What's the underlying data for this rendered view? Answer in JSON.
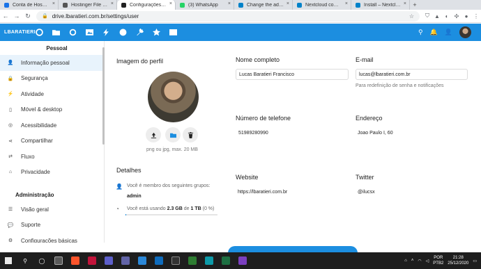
{
  "browser": {
    "tabs": [
      {
        "title": "Conta de Hospedagem",
        "color": "#1a73e8",
        "active": false
      },
      {
        "title": "Hostinger File Manager",
        "color": "#555555",
        "active": false
      },
      {
        "title": "Configurações - drive",
        "color": "#222222",
        "active": true
      },
      {
        "title": "(3) WhatsApp",
        "color": "#25d366",
        "active": false
      },
      {
        "title": "Change the address of",
        "color": "#0082c9",
        "active": false
      },
      {
        "title": "Nextcloud community",
        "color": "#0082c9",
        "active": false
      },
      {
        "title": "Install – Nextcloud",
        "color": "#0082c9",
        "active": false
      }
    ],
    "url": "drive.lbaratieri.com.br/settings/user"
  },
  "header": {
    "logo": "LBARATIERI",
    "apps": [
      "dashboard-icon",
      "files-icon",
      "talk-icon",
      "photos-icon",
      "activity-icon",
      "circles-icon",
      "settings-icon",
      "favorites-icon",
      "contacts-icon"
    ]
  },
  "sidebar": {
    "personal_heading": "Pessoal",
    "personal_items": [
      {
        "label": "Informação pessoal",
        "icon": "person-icon",
        "glyph": "👤",
        "active": true
      },
      {
        "label": "Segurança",
        "icon": "lock-icon",
        "glyph": "🔒",
        "active": false
      },
      {
        "label": "Atividade",
        "icon": "lightning-icon",
        "glyph": "⚡",
        "active": false
      },
      {
        "label": "Móvel & desktop",
        "icon": "phone-icon",
        "glyph": "▯",
        "active": false
      },
      {
        "label": "Acessibilidade",
        "icon": "accessibility-icon",
        "glyph": "◎",
        "active": false
      },
      {
        "label": "Compartilhar",
        "icon": "share-icon",
        "glyph": "⋖",
        "active": false
      },
      {
        "label": "Fluxo",
        "icon": "flow-icon",
        "glyph": "⇄",
        "active": false
      },
      {
        "label": "Privacidade",
        "icon": "privacy-icon",
        "glyph": "⌂",
        "active": false
      }
    ],
    "admin_heading": "Administração",
    "admin_items": [
      {
        "label": "Visão geral",
        "icon": "list-icon",
        "glyph": "☰"
      },
      {
        "label": "Suporte",
        "icon": "chat-icon",
        "glyph": "💬"
      },
      {
        "label": "Configurações básicas",
        "icon": "gear-icon",
        "glyph": "⚙"
      }
    ]
  },
  "profile": {
    "picture_label": "Imagem do perfil",
    "picture_hint": "png ou jpg, max. 20 MB",
    "details_label": "Detalhes",
    "groups_text": "Você é membro dos seguintes grupos:",
    "group_name": "admin",
    "quota_prefix": "Você está usando",
    "quota_used": "2.3 GB",
    "quota_of": "de",
    "quota_total": "1 TB",
    "quota_percent": "(0 %)",
    "quota_fraction": 0.002
  },
  "fields": {
    "fullname_label": "Nome completo",
    "fullname_value": "Lucas Baratieri Francisco",
    "email_label": "E-mail",
    "email_value": "lucas@lbaratieri.com.br",
    "email_hint": "Para redefinição de senha e notificações",
    "phone_label": "Número de telefone",
    "phone_value": "51989280990",
    "address_label": "Endereço",
    "address_value": "Joao Paulo I, 60",
    "website_label": "Website",
    "website_value": "https://lbaratieri.com.br",
    "twitter_label": "Twitter",
    "twitter_value": "@ilucsx"
  },
  "taskbar": {
    "lang": "POR",
    "layout": "PTB2",
    "time": "21:28",
    "date": "25/12/2020"
  }
}
